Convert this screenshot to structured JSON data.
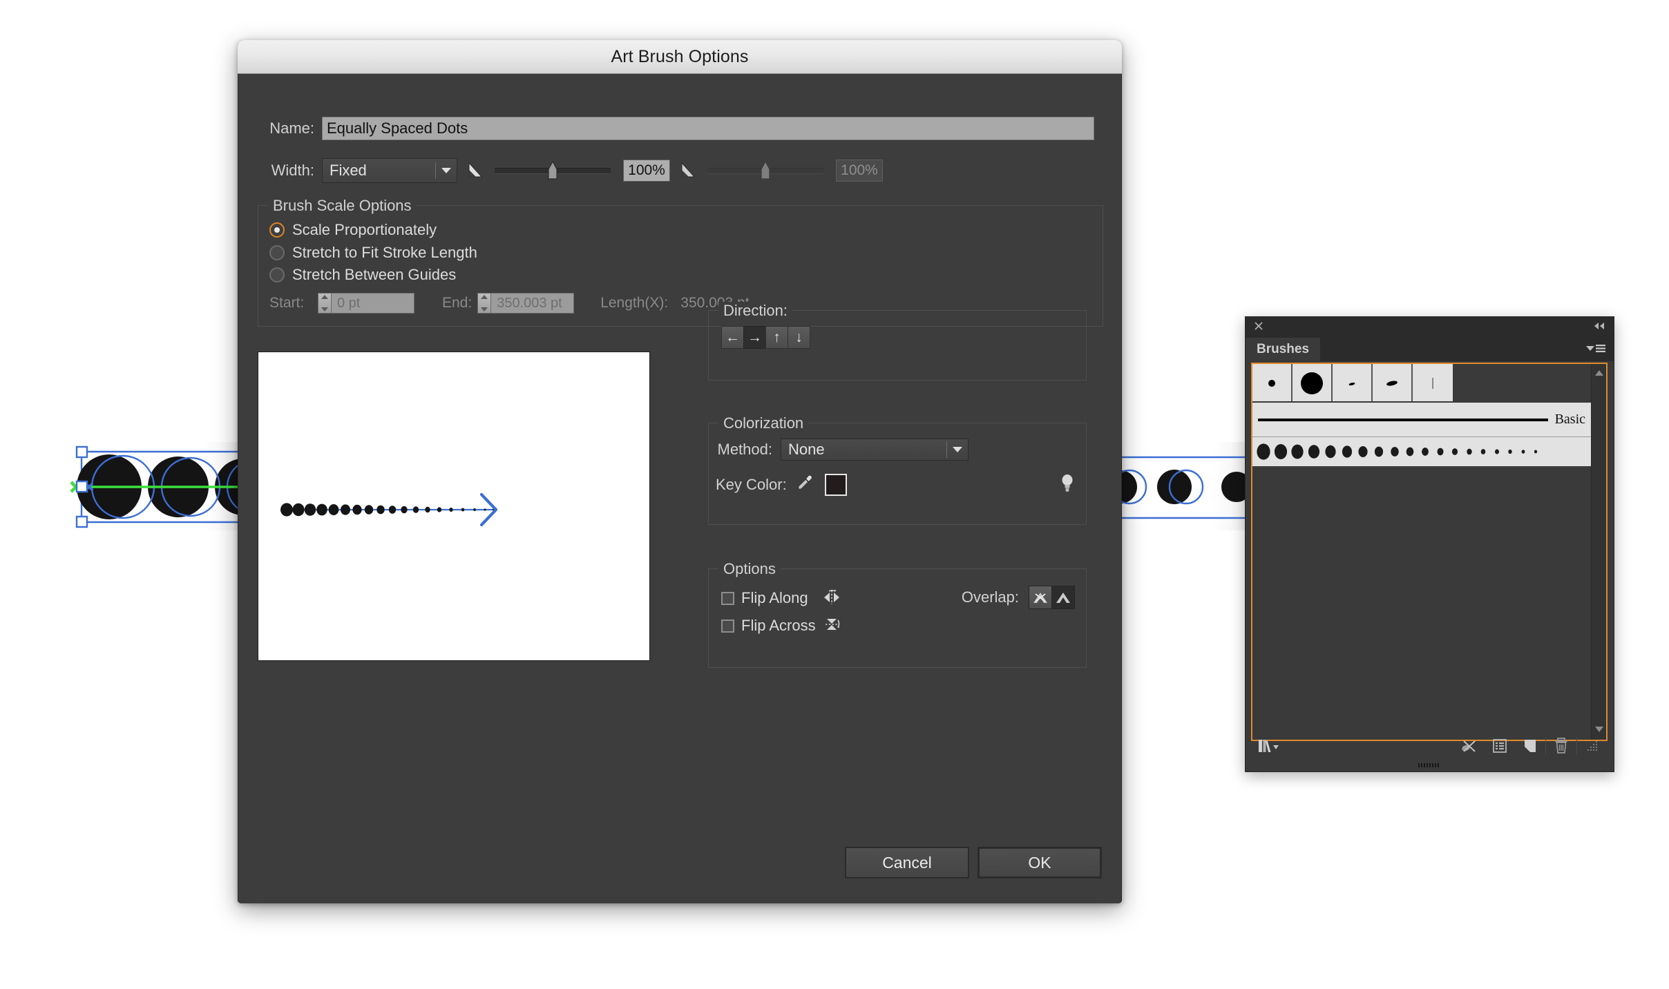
{
  "dialog": {
    "title": "Art Brush Options",
    "name_label": "Name:",
    "name_value": "Equally Spaced Dots",
    "width_label": "Width:",
    "width_value": "Fixed",
    "width_pct_1": "100%",
    "width_pct_2": "100%"
  },
  "scale": {
    "group_title": "Brush Scale Options",
    "options": [
      {
        "label": "Scale Proportionately",
        "selected": true
      },
      {
        "label": "Stretch to Fit Stroke Length",
        "selected": false
      },
      {
        "label": "Stretch Between Guides",
        "selected": false
      }
    ],
    "start_label": "Start:",
    "start_value": "0 pt",
    "end_label": "End:",
    "end_value": "350.003 pt",
    "length_label": "Length(X):",
    "length_value": "350.003 pt"
  },
  "direction": {
    "group_title": "Direction:",
    "buttons": [
      {
        "name": "left",
        "glyph": "←",
        "active": false
      },
      {
        "name": "right",
        "glyph": "→",
        "active": true
      },
      {
        "name": "up",
        "glyph": "↑",
        "active": false
      },
      {
        "name": "down",
        "glyph": "↓",
        "active": false
      }
    ]
  },
  "colorization": {
    "group_title": "Colorization",
    "method_label": "Method:",
    "method_value": "None",
    "key_color_label": "Key Color:",
    "key_color_hex": "#231c1c"
  },
  "options": {
    "group_title": "Options",
    "flip_along_label": "Flip Along",
    "flip_along_checked": false,
    "flip_across_label": "Flip Across",
    "flip_across_checked": false,
    "overlap_label": "Overlap:",
    "overlap_selected": "allow"
  },
  "buttons": {
    "cancel": "Cancel",
    "ok": "OK"
  },
  "preview": {
    "dot_count": 19,
    "arrow_color": "#3b6fd4",
    "dot_color": "#151515"
  },
  "panel": {
    "tab_label": "Brushes",
    "basic_label": "Basic",
    "swatches": [
      "small-dot",
      "large-circle",
      "tiny-dash",
      "comma-dash",
      "thin-line"
    ],
    "dot_count": 19,
    "selection_color": "#e08a2d"
  },
  "colors": {
    "dialog_bg": "#3d3d3d",
    "accent_orange": "#e08326",
    "selection_blue": "#3b6fd4",
    "guide_green": "#3ce03c"
  }
}
